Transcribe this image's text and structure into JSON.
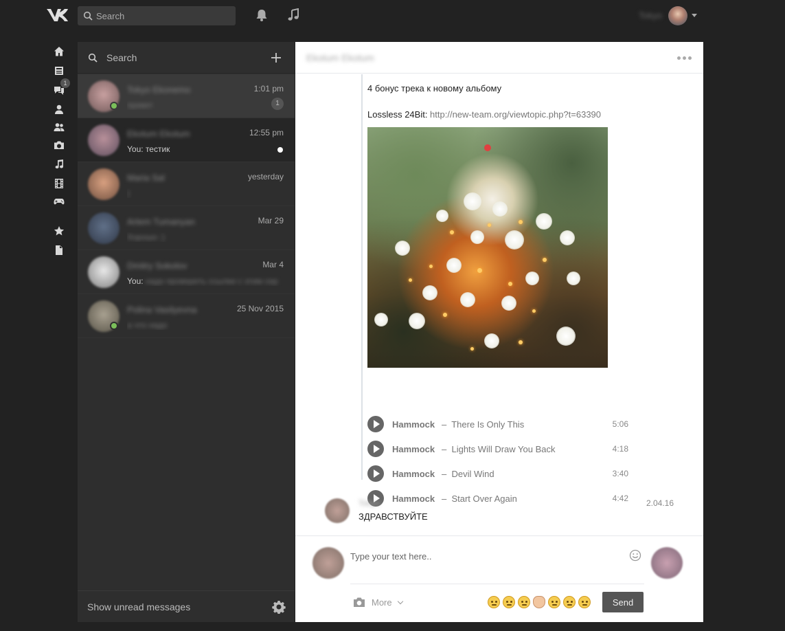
{
  "topbar": {
    "logo": "vk-logo-icon",
    "search_placeholder": "Search",
    "user_name": "Tokyo"
  },
  "leftnav": {
    "items": [
      {
        "icon": "home-icon"
      },
      {
        "icon": "news-icon"
      },
      {
        "icon": "messages-icon",
        "badge": "1"
      },
      {
        "icon": "user-icon"
      },
      {
        "icon": "friends-icon"
      },
      {
        "icon": "camera-icon"
      },
      {
        "icon": "music-icon"
      },
      {
        "icon": "video-icon"
      },
      {
        "icon": "games-icon"
      },
      {
        "icon": "star-icon"
      },
      {
        "icon": "document-icon"
      }
    ]
  },
  "dialogs": {
    "search_placeholder": "Search",
    "items": [
      {
        "name": "Tokyo Ekonemo",
        "time": "1:01 pm",
        "preview_you": "",
        "preview": "привет",
        "unread": "1",
        "online": true
      },
      {
        "name": "Ekotum Ekotum",
        "time": "12:55 pm",
        "preview_you": "You:",
        "preview": "тестик",
        "unread_dot": true,
        "online": false
      },
      {
        "name": "Maria Sal",
        "time": "yesterday",
        "preview_you": "",
        "preview": ")",
        "online": false
      },
      {
        "name": "Artem Tumanyan",
        "time": "Mar 29",
        "preview_you": "",
        "preview": "Хорошо :)",
        "online": false
      },
      {
        "name": "Dmitry Sokolov",
        "time": "Mar 4",
        "preview_you": "You:",
        "preview": "надо проверить ссылки с этим сер",
        "online": false
      },
      {
        "name": "Polina Vasilyevna",
        "time": "25 Nov 2015",
        "preview_you": "",
        "preview": "а что надо",
        "online": true
      }
    ],
    "footer_label": "Show unread messages"
  },
  "chat": {
    "title": "Ekotum Ekotum",
    "message_text1": "4 бонус трека к новому альбому",
    "message_text2_prefix": "Lossless 24Bit: ",
    "message_link": "http://new-team.org/viewtopic.php?t=63390",
    "tracks": [
      {
        "artist": "Hammock",
        "title": "There Is Only This",
        "duration": "5:06"
      },
      {
        "artist": "Hammock",
        "title": "Lights Will Draw You Back",
        "duration": "4:18"
      },
      {
        "artist": "Hammock",
        "title": "Devil Wind",
        "duration": "3:40"
      },
      {
        "artist": "Hammock",
        "title": "Start Over Again",
        "duration": "4:42"
      }
    ],
    "track_separator": "–",
    "msg2_name": "Tokyo",
    "msg2_date": "2.04.16",
    "msg2_text": "ЗДРАВСТВУЙТЕ",
    "msg2_tail": "...",
    "composer_placeholder": "Type your text here..",
    "more_label": "More",
    "send_label": "Send"
  }
}
